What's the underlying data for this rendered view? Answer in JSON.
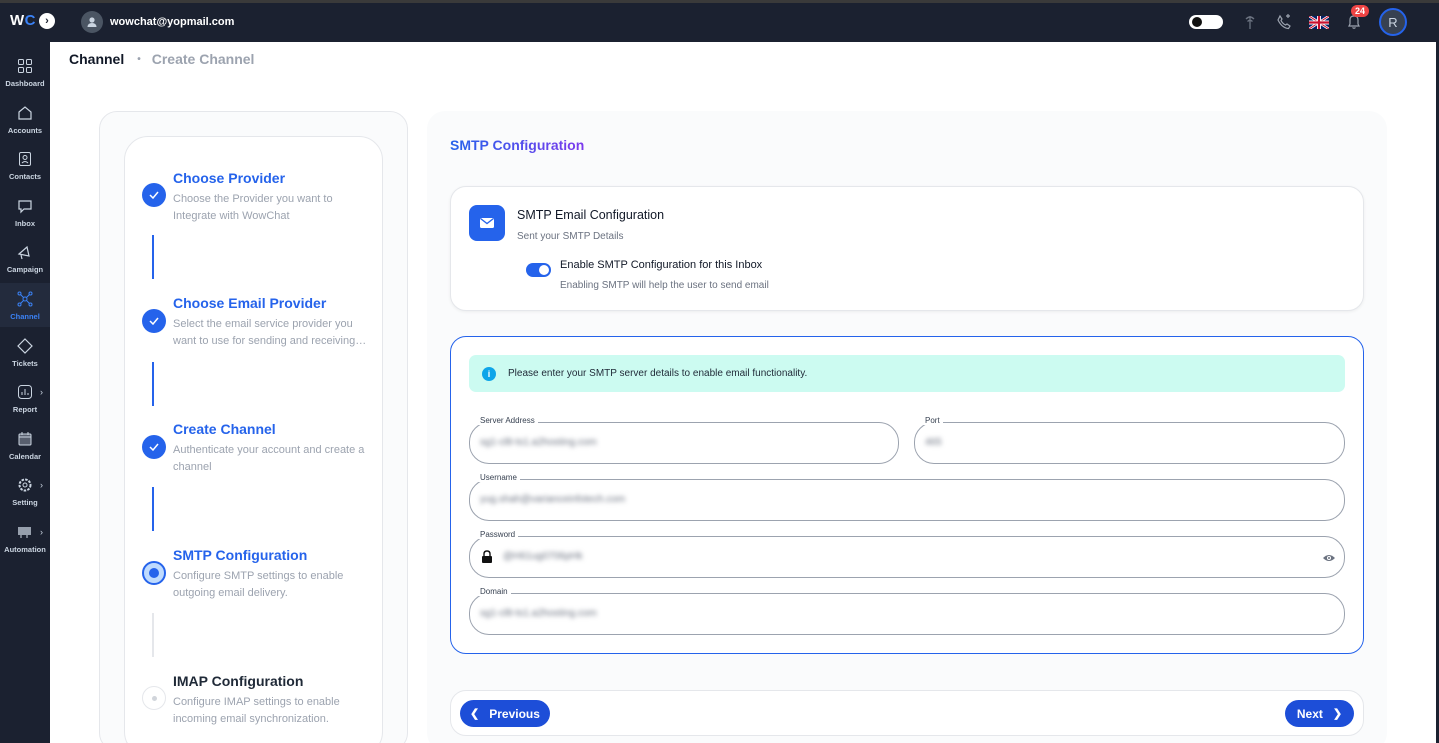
{
  "app": {
    "logo": "WC",
    "user_email": "wowchat@yopmail.com",
    "notification_count": "24",
    "avatar_initial": "R"
  },
  "sidebar": {
    "items": [
      {
        "label": "Dashboard",
        "icon": "dashboard-icon"
      },
      {
        "label": "Accounts",
        "icon": "home-icon"
      },
      {
        "label": "Contacts",
        "icon": "contacts-icon"
      },
      {
        "label": "Inbox",
        "icon": "inbox-icon"
      },
      {
        "label": "Campaign",
        "icon": "megaphone-icon"
      },
      {
        "label": "Channel",
        "icon": "channel-icon",
        "active": true
      },
      {
        "label": "Tickets",
        "icon": "ticket-icon"
      },
      {
        "label": "Report",
        "icon": "report-icon"
      },
      {
        "label": "Calendar",
        "icon": "calendar-icon"
      },
      {
        "label": "Setting",
        "icon": "gear-icon"
      },
      {
        "label": "Automation",
        "icon": "automation-icon"
      }
    ]
  },
  "breadcrumb": {
    "current": "Channel",
    "next": "Create Channel"
  },
  "steps": [
    {
      "title": "Choose Provider",
      "desc": "Choose the Provider you want to Integrate with WowChat",
      "status": "done"
    },
    {
      "title": "Choose Email Provider",
      "desc": "Select the email service provider you want to use for sending and receiving emails",
      "status": "done"
    },
    {
      "title": "Create Channel",
      "desc": "Authenticate your account and create a channel",
      "status": "done"
    },
    {
      "title": "SMTP Configuration",
      "desc": "Configure SMTP settings to enable outgoing email delivery.",
      "status": "current"
    },
    {
      "title": "IMAP Configuration",
      "desc": "Configure IMAP settings to enable incoming email synchronization.",
      "status": "pending"
    }
  ],
  "main": {
    "title": "SMTP Configuration",
    "email_card": {
      "title": "SMTP Email Configuration",
      "subtitle": "Sent your SMTP Details",
      "toggle_label": "Enable SMTP Configuration for this Inbox",
      "toggle_hint": "Enabling SMTP will help the user to send email",
      "toggle_on": true
    },
    "info": "Please enter your SMTP server details to enable email functionality.",
    "form": {
      "server_address": {
        "label": "Server Address",
        "value": "sg1-cl8-ts1.a2hosting.com"
      },
      "port": {
        "label": "Port",
        "value": "465"
      },
      "username": {
        "label": "Username",
        "value": "yug.shah@varianceinfotech.com"
      },
      "password": {
        "label": "Password",
        "value": "@H61ug0706pHk"
      },
      "domain": {
        "label": "Domain",
        "value": "sg1-cl8-ts1.a2hosting.com"
      }
    },
    "buttons": {
      "previous": "Previous",
      "next": "Next"
    }
  },
  "colors": {
    "accent": "#2563eb",
    "sidebar_bg": "#1b2130",
    "info_bg": "#ccfbf1"
  }
}
